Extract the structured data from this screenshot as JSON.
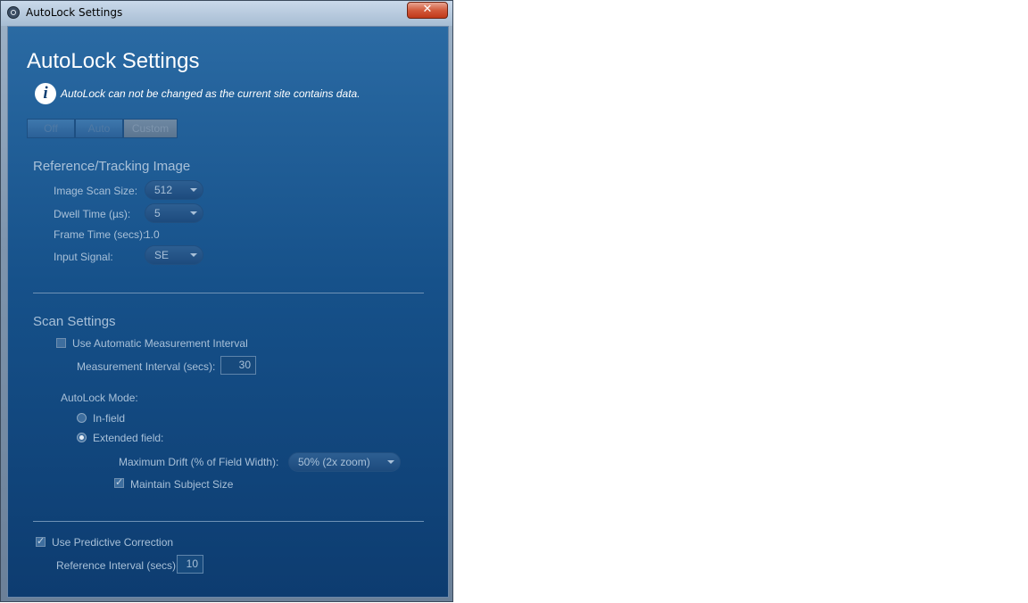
{
  "window": {
    "title": "AutoLock Settings",
    "close_glyph": "✕"
  },
  "header": {
    "title": "AutoLock Settings",
    "notice": "AutoLock can not be changed as the current site contains data."
  },
  "mode_toggle": {
    "options": [
      "Off",
      "Auto",
      "Custom"
    ],
    "selected": "Custom"
  },
  "reference_tracking": {
    "title": "Reference/Tracking Image",
    "image_scan_size_label": "Image Scan Size:",
    "image_scan_size_value": "512",
    "dwell_time_label": "Dwell Time (µs):",
    "dwell_time_value": "5",
    "frame_time_label": "Frame Time (secs):",
    "frame_time_value": "1.0",
    "input_signal_label": "Input Signal:",
    "input_signal_value": "SE"
  },
  "scan_settings": {
    "title": "Scan Settings",
    "auto_interval_label": "Use Automatic Measurement Interval",
    "auto_interval_checked": false,
    "measurement_interval_label": "Measurement Interval (secs):",
    "measurement_interval_value": "30",
    "autolock_mode_label": "AutoLock Mode:",
    "in_field_label": "In-field",
    "extended_field_label": "Extended field:",
    "selected_mode": "Extended field",
    "max_drift_label": "Maximum Drift (% of Field Width):",
    "max_drift_value": "50% (2x zoom)",
    "maintain_size_label": "Maintain Subject Size",
    "maintain_size_checked": true
  },
  "predictive": {
    "use_predictive_label": "Use Predictive Correction",
    "use_predictive_checked": true,
    "reference_interval_label": "Reference Interval (secs):",
    "reference_interval_value": "10"
  }
}
